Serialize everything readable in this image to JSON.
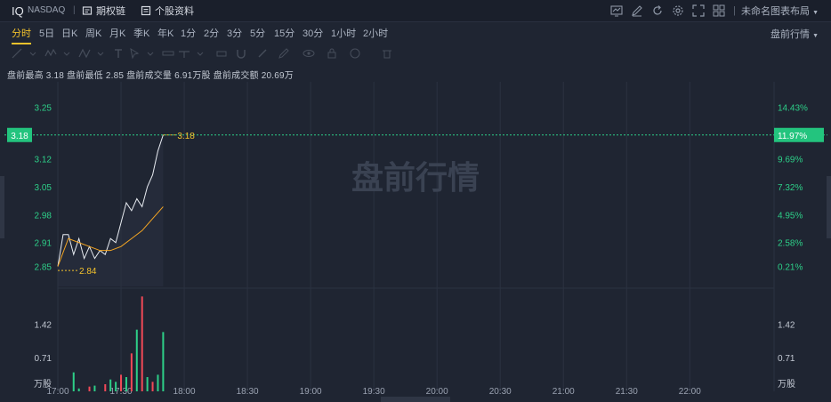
{
  "header": {
    "symbol": "IQ",
    "exchange": "NASDAQ",
    "options_chain_label": "期权链",
    "stock_profile_label": "个股资料",
    "layout_label": "未命名图表布局"
  },
  "tabs": [
    "分时",
    "5日",
    "日K",
    "周K",
    "月K",
    "季K",
    "年K",
    "1分",
    "2分",
    "3分",
    "5分",
    "15分",
    "30分",
    "1小时",
    "2小时"
  ],
  "active_tab": "分时",
  "premarket_mode_label": "盘前行情",
  "stats": {
    "high_label": "盘前最高",
    "high": "3.18",
    "low_label": "盘前最低",
    "low": "2.85",
    "volume_label": "盘前成交量",
    "volume": "6.91万股",
    "turnover_label": "盘前成交额",
    "turnover": "20.69万"
  },
  "watermark": "盘前行情",
  "colors": {
    "background": "#1f2532",
    "up": "#f24957",
    "down": "#2dcf88",
    "price_line": "#e8ecf2",
    "avg_line": "#f5a623",
    "accent": "#f3c22c"
  },
  "chart_data": {
    "type": "line",
    "price_axis": {
      "ticks": [
        "3.25",
        "3.18",
        "3.12",
        "3.05",
        "2.98",
        "2.91",
        "2.85"
      ],
      "ylim": [
        2.8,
        3.3
      ]
    },
    "pct_axis": {
      "ticks": [
        "14.43%",
        "11.97%",
        "9.69%",
        "7.32%",
        "4.95%",
        "2.58%",
        "0.21%"
      ]
    },
    "current_price": "3.18",
    "current_pct": "11.97%",
    "high_marker": "3.18",
    "low_marker": "2.84",
    "time_ticks": [
      "17:00",
      "17:30",
      "18:00",
      "18:30",
      "19:00",
      "19:30",
      "20:00",
      "20:30",
      "21:00",
      "21:30",
      "22:00"
    ],
    "time_range_minutes": [
      0,
      340
    ],
    "volume_axis": {
      "ticks": [
        "1.42",
        "0.71"
      ],
      "unit": "万股",
      "max": 2.1
    },
    "series": [
      {
        "name": "price",
        "x": [
          0,
          1,
          2,
          3,
          4,
          5,
          6,
          7,
          8,
          9,
          10,
          11,
          12,
          13,
          14,
          15,
          16,
          17,
          18,
          19,
          20
        ],
        "values": [
          2.85,
          2.93,
          2.93,
          2.88,
          2.92,
          2.87,
          2.9,
          2.87,
          2.89,
          2.88,
          2.92,
          2.91,
          2.96,
          3.01,
          2.99,
          3.02,
          3.0,
          3.05,
          3.08,
          3.14,
          3.18
        ]
      },
      {
        "name": "avg",
        "x": [
          0,
          2,
          4,
          6,
          8,
          10,
          12,
          14,
          16,
          18,
          20
        ],
        "values": [
          2.85,
          2.92,
          2.91,
          2.9,
          2.89,
          2.89,
          2.9,
          2.92,
          2.94,
          2.97,
          3.0
        ]
      }
    ],
    "volume": {
      "x": [
        3,
        4,
        6,
        7,
        9,
        10,
        11,
        12,
        13,
        14,
        15,
        16,
        17,
        18,
        19,
        20
      ],
      "values": [
        0.4,
        0.06,
        0.1,
        0.12,
        0.15,
        0.25,
        0.2,
        0.35,
        0.3,
        0.8,
        1.3,
        2.0,
        0.3,
        0.2,
        0.35,
        1.25
      ],
      "up": [
        false,
        false,
        true,
        false,
        true,
        false,
        false,
        true,
        false,
        true,
        false,
        true,
        false,
        true,
        false,
        false
      ]
    }
  }
}
